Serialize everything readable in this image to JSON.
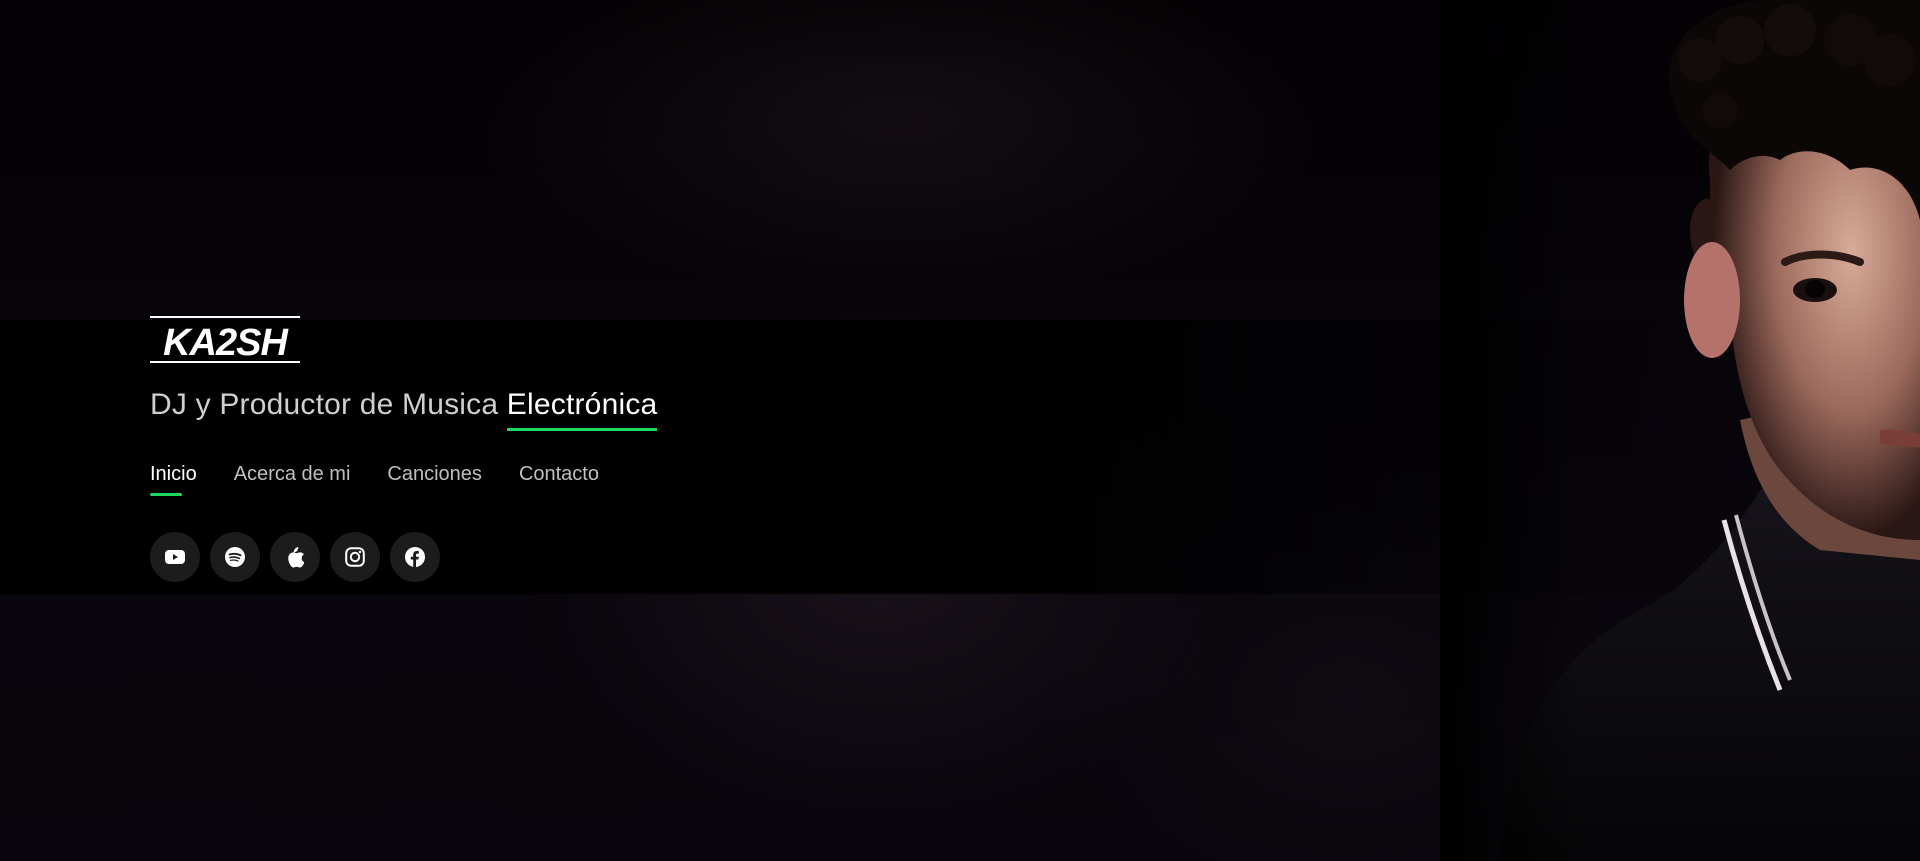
{
  "brand": {
    "logo_text": "KA2SH"
  },
  "hero": {
    "tagline_prefix": "DJ y Productor de Musica ",
    "tagline_highlight": "Electrónica"
  },
  "nav": {
    "items": [
      {
        "label": "Inicio",
        "active": true
      },
      {
        "label": "Acerca de mi",
        "active": false
      },
      {
        "label": "Canciones",
        "active": false
      },
      {
        "label": "Contacto",
        "active": false
      }
    ]
  },
  "socials": [
    {
      "icon": "youtube-icon"
    },
    {
      "icon": "spotify-icon"
    },
    {
      "icon": "apple-icon"
    },
    {
      "icon": "instagram-icon"
    },
    {
      "icon": "facebook-icon"
    }
  ],
  "colors": {
    "accent": "#1ed760",
    "background": "#000000",
    "text": "#ffffff",
    "muted_text": "#bfbfbf",
    "social_bg": "#1c1c1c"
  }
}
